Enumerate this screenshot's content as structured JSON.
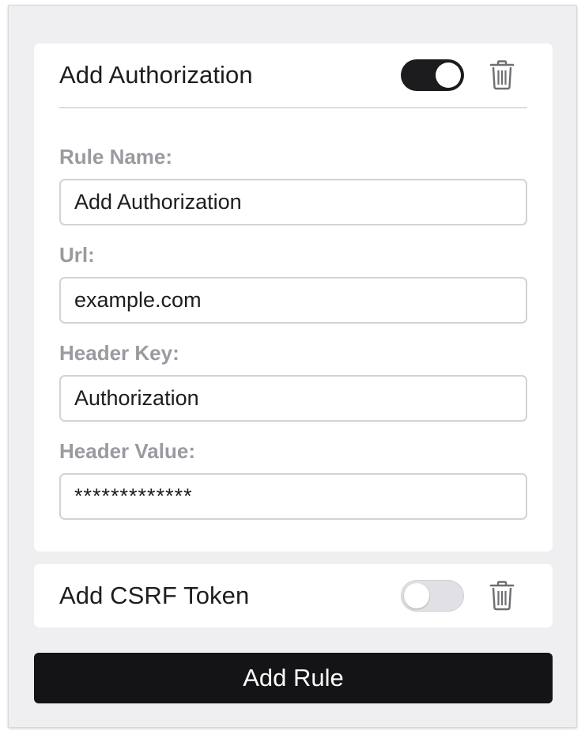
{
  "rules": [
    {
      "title": "Add Authorization",
      "enabled": true,
      "fields": {
        "rule_name": {
          "label": "Rule Name:",
          "value": "Add Authorization"
        },
        "url": {
          "label": "Url:",
          "value": "example.com"
        },
        "header_key": {
          "label": "Header Key:",
          "value": "Authorization"
        },
        "header_value": {
          "label": "Header Value:",
          "value": "*************"
        }
      }
    },
    {
      "title": "Add CSRF Token",
      "enabled": false
    }
  ],
  "add_rule_label": "Add Rule",
  "colors": {
    "panel_bg": "#efeff1",
    "card_bg": "#ffffff",
    "toggle_on": "#1c1c1e",
    "toggle_off": "#e1e1e5",
    "label_gray": "#9a9aa0",
    "button_bg": "#141416"
  },
  "icons": {
    "delete": "trash-icon"
  }
}
